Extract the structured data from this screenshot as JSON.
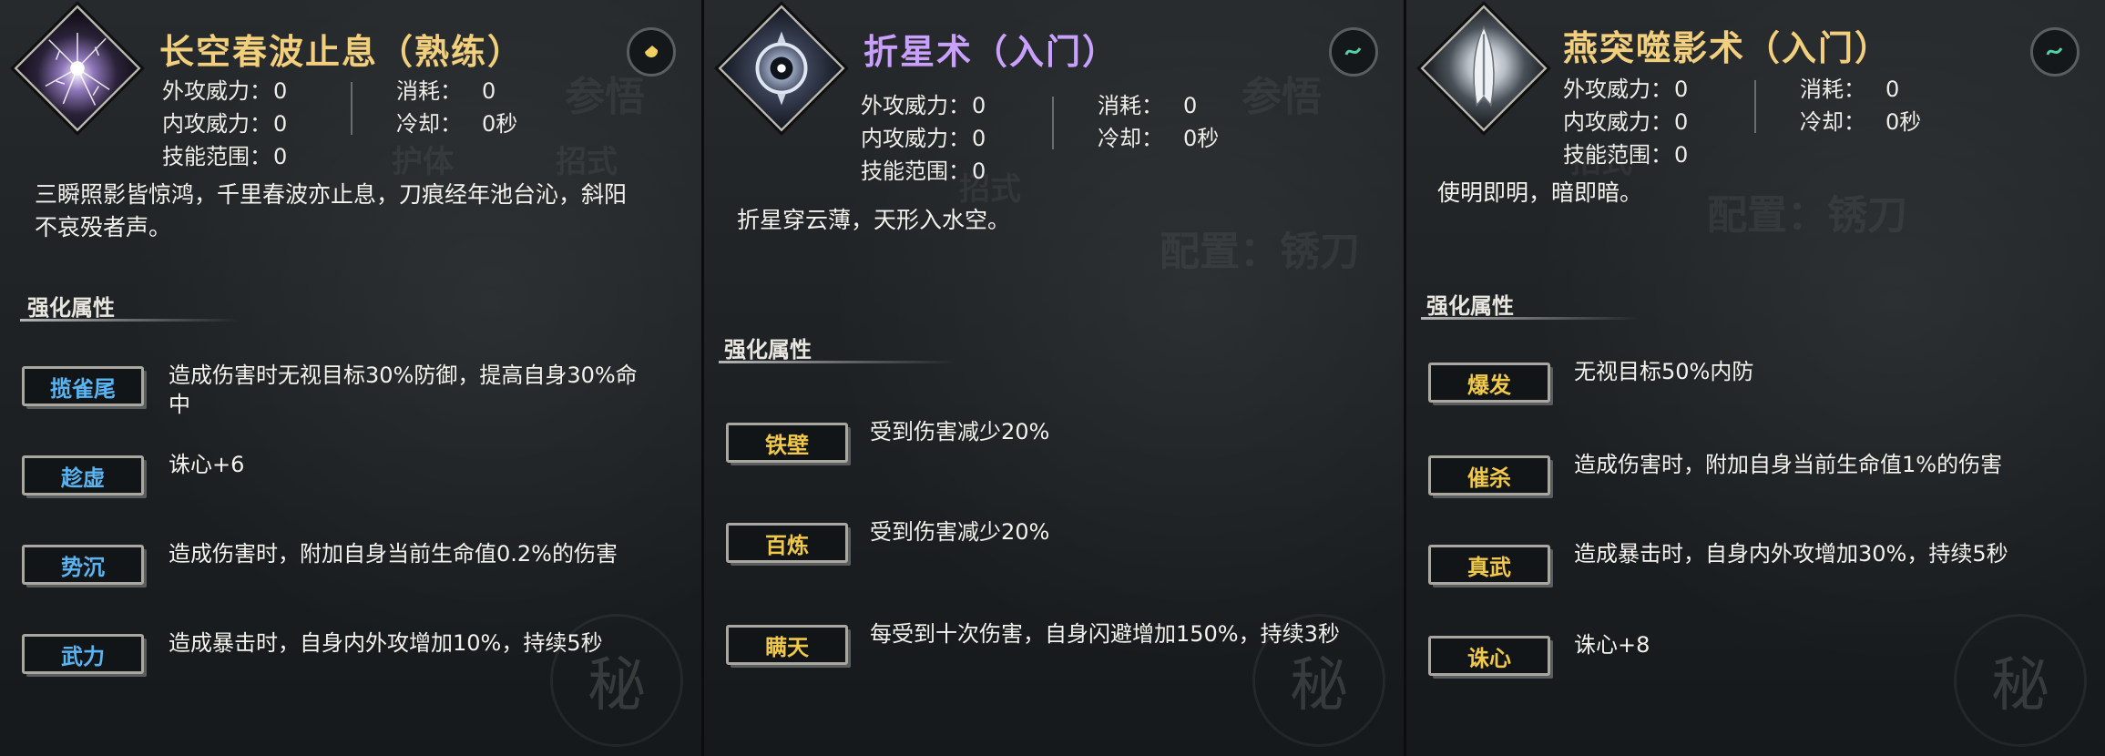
{
  "colors": {
    "gold_title": "#f2cf7c",
    "purple_title": "#c9a0ff",
    "blue_tag": "#5ab4f2",
    "gold_tag": "#f0c84a"
  },
  "labels": {
    "outer_attack": "外攻威力：",
    "inner_attack": "内攻威力：",
    "skill_range": "技能范围：",
    "cost": "消耗：",
    "cooldown": "冷却：",
    "enhance": "强化属性"
  },
  "panels": [
    {
      "title": "长空春波止息（熟练）",
      "badge_icon": "gold-coin-icon",
      "skill_icon": "lightning-burst-icon",
      "outer_attack": "0",
      "inner_attack": "0",
      "range": "0",
      "cost": "0",
      "cooldown": "0秒",
      "desc_line1": "三瞬照影皆惊鸿，千里春波亦止息，刀痕经年池台沁，斜阳",
      "desc_line2": "不哀殁者声。",
      "bg_texts": [
        "参悟",
        "护体",
        "招式",
        "秘"
      ],
      "attrs": [
        {
          "tag": "揽雀尾",
          "text1": "造成伤害时无视目标30%防御，提高自身30%命",
          "text2": "中"
        },
        {
          "tag": "趁虚",
          "text1": "诛心+6",
          "text2": ""
        },
        {
          "tag": "势沉",
          "text1": "造成伤害时，附加自身当前生命值0.2%的伤害",
          "text2": ""
        },
        {
          "tag": "武力",
          "text1": "造成暴击时，自身内外攻增加10%，持续5秒",
          "text2": ""
        }
      ]
    },
    {
      "title": "折星术（入门）",
      "badge_icon": "jade-swirl-icon",
      "skill_icon": "star-orb-icon",
      "outer_attack": "0",
      "inner_attack": "0",
      "range": "0",
      "cost": "0",
      "cooldown": "0秒",
      "desc_line1": "折星穿云薄，天形入水空。",
      "desc_line2": "",
      "bg_texts": [
        "参悟",
        "招式",
        "配置：锈刀",
        "秘"
      ],
      "attrs": [
        {
          "tag": "铁壁",
          "text1": "受到伤害减少20%",
          "text2": ""
        },
        {
          "tag": "百炼",
          "text1": "受到伤害减少20%",
          "text2": ""
        },
        {
          "tag": "瞒天",
          "text1": "每受到十次伤害，自身闪避增加150%，持续3秒",
          "text2": ""
        }
      ]
    },
    {
      "title": "燕突噬影术（入门）",
      "badge_icon": "jade-swirl-icon",
      "skill_icon": "blade-shadow-icon",
      "outer_attack": "0",
      "inner_attack": "0",
      "range": "0",
      "cost": "0",
      "cooldown": "0秒",
      "desc_line1": "使明即明，暗即暗。",
      "desc_line2": "",
      "bg_texts": [
        "配置：锈刀",
        "招式",
        "秘"
      ],
      "attrs": [
        {
          "tag": "爆发",
          "text1": "无视目标50%内防",
          "text2": ""
        },
        {
          "tag": "催杀",
          "text1": "造成伤害时，附加自身当前生命值1%的伤害",
          "text2": ""
        },
        {
          "tag": "真武",
          "text1": "造成暴击时，自身内外攻增加30%，持续5秒",
          "text2": ""
        },
        {
          "tag": "诛心",
          "text1": "诛心+8",
          "text2": ""
        }
      ]
    }
  ]
}
